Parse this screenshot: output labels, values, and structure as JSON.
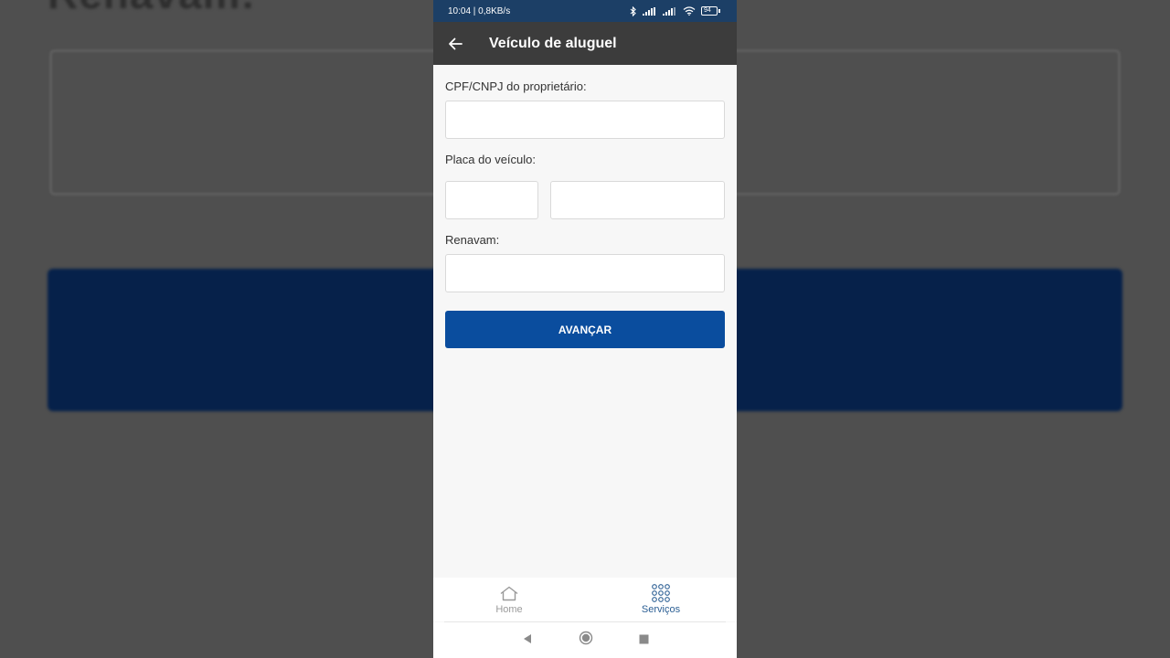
{
  "background": {
    "blurred_text": "Renavam:"
  },
  "status_bar": {
    "time_speed": "10:04 | 0,8KB/s",
    "battery": "94"
  },
  "app_bar": {
    "title": "Veículo de aluguel",
    "back_icon": "arrow-left-icon"
  },
  "form": {
    "cpf_label": "CPF/CNPJ do proprietário:",
    "cpf_value": "",
    "plate_label": "Placa do veículo:",
    "plate_letters_value": "",
    "plate_numbers_value": "",
    "renavam_label": "Renavam:",
    "renavam_value": "",
    "submit_label": "AVANÇAR"
  },
  "bottom_nav": {
    "items": [
      {
        "label": "Home",
        "icon": "home-icon",
        "active": false
      },
      {
        "label": "Serviços",
        "icon": "grid-dots-icon",
        "active": true
      }
    ]
  },
  "colors": {
    "status_bar": "#1c3f66",
    "app_bar": "#3c3c3c",
    "primary_button": "#0a4d9e",
    "active_nav": "#2c5f94",
    "inactive_nav": "#9a9a9a"
  }
}
